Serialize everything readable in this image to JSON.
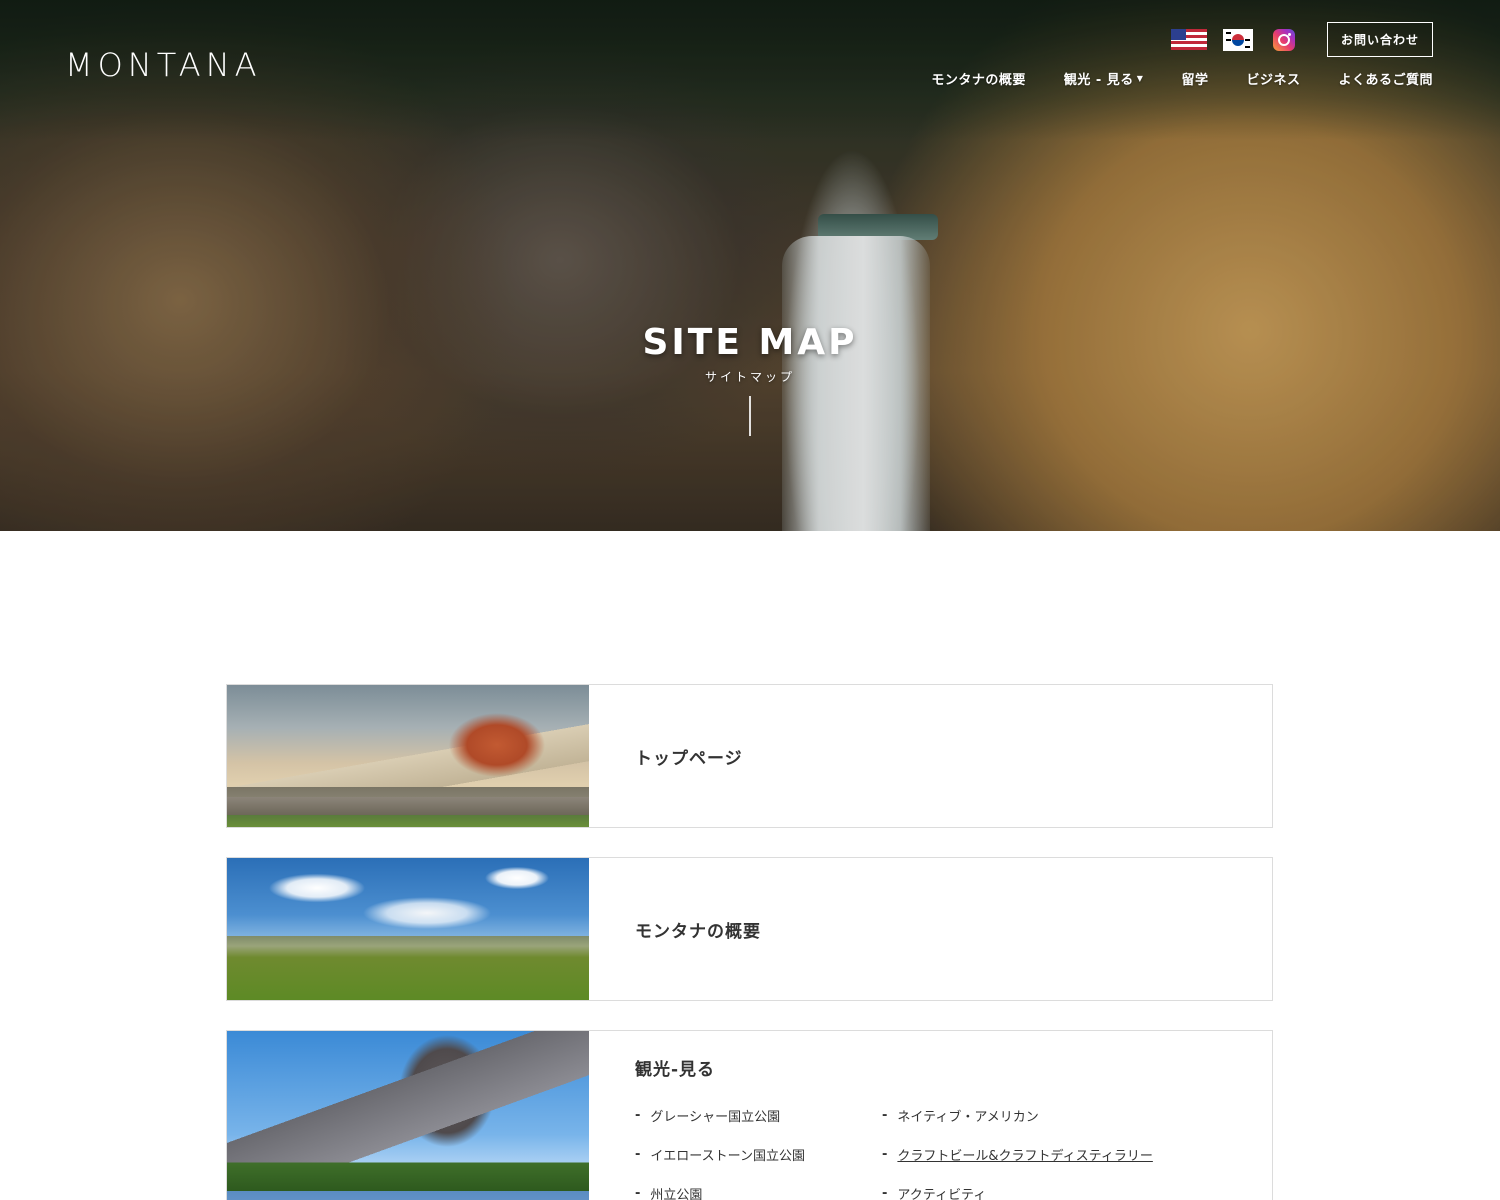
{
  "header": {
    "logo": "MONTANA",
    "contact_label": "お問い合わせ",
    "nav": [
      {
        "label": "モンタナの概要",
        "dropdown": false
      },
      {
        "label": "観光 - 見る",
        "dropdown": true
      },
      {
        "label": "留学",
        "dropdown": false
      },
      {
        "label": "ビジネス",
        "dropdown": false
      },
      {
        "label": "よくあるご質問",
        "dropdown": false
      }
    ],
    "caret": "▼"
  },
  "hero": {
    "title": "SITE MAP",
    "subtitle": "サイトマップ"
  },
  "cards": [
    {
      "title": "トップページ"
    },
    {
      "title": "モンタナの概要"
    },
    {
      "title": "観光-見る",
      "links": [
        {
          "label": "グレーシャー国立公園"
        },
        {
          "label": "ネイティブ・アメリカン"
        },
        {
          "label": "イエローストーン国立公園"
        },
        {
          "label": "クラフトビール&クラフトディスティラリー"
        },
        {
          "label": "州立公園"
        },
        {
          "label": "アクティビティ"
        }
      ]
    }
  ],
  "dash": "-"
}
